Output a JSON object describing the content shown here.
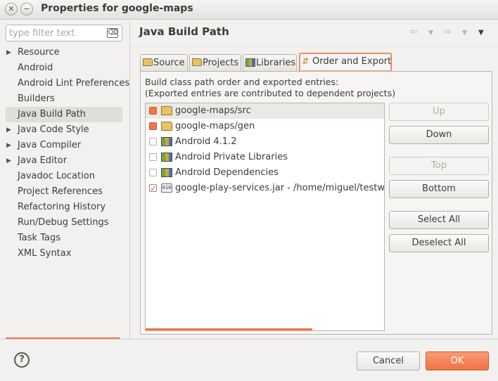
{
  "window": {
    "title": "Properties for google-maps",
    "close_glyph": "✕",
    "minimize_glyph": "−"
  },
  "sidebar": {
    "filter_placeholder": "type filter text",
    "filter_value": "",
    "items": [
      {
        "label": "Resource",
        "expandable": true
      },
      {
        "label": "Android",
        "expandable": false
      },
      {
        "label": "Android Lint Preferences",
        "expandable": false
      },
      {
        "label": "Builders",
        "expandable": false
      },
      {
        "label": "Java Build Path",
        "expandable": false,
        "selected": true
      },
      {
        "label": "Java Code Style",
        "expandable": true
      },
      {
        "label": "Java Compiler",
        "expandable": true
      },
      {
        "label": "Java Editor",
        "expandable": true
      },
      {
        "label": "Javadoc Location",
        "expandable": false
      },
      {
        "label": "Project References",
        "expandable": false
      },
      {
        "label": "Refactoring History",
        "expandable": false
      },
      {
        "label": "Run/Debug Settings",
        "expandable": false
      },
      {
        "label": "Task Tags",
        "expandable": false
      },
      {
        "label": "XML Syntax",
        "expandable": false
      }
    ]
  },
  "page": {
    "title": "Java Build Path",
    "icons": [
      "back-arrow-icon",
      "back-dropdown-icon",
      "forward-arrow-icon",
      "forward-dropdown-icon",
      "view-menu-icon"
    ]
  },
  "tabs": [
    {
      "label": "Source",
      "icon": "source-folder-icon"
    },
    {
      "label": "Projects",
      "icon": "projects-folder-icon"
    },
    {
      "label": "Libraries",
      "icon": "libraries-icon"
    },
    {
      "label": "Order and Export",
      "icon": "order-export-icon",
      "active": true
    }
  ],
  "order_export": {
    "description_line1": "Build class path order and exported entries:",
    "description_line2": "(Exported entries are contributed to dependent projects)",
    "entries": [
      {
        "label": "google-maps/src",
        "checked": true,
        "icon": "package-folder-icon",
        "selected": true
      },
      {
        "label": "google-maps/gen",
        "checked": true,
        "icon": "package-folder-icon"
      },
      {
        "label": "Android 4.1.2",
        "checked": false,
        "icon": "library-icon"
      },
      {
        "label": "Android Private Libraries",
        "checked": false,
        "icon": "library-icon"
      },
      {
        "label": "Android Dependencies",
        "checked": false,
        "icon": "library-icon"
      },
      {
        "label": "google-play-services.jar - /home/miguel/testworks",
        "checked": true,
        "icon": "jar-icon"
      }
    ],
    "jar_icon_text": "010",
    "buttons": {
      "up": "Up",
      "down": "Down",
      "top": "Top",
      "bottom": "Bottom",
      "select_all": "Select All",
      "deselect_all": "Deselect All"
    }
  },
  "footer": {
    "help_glyph": "?",
    "cancel_label": "Cancel",
    "ok_label": "OK"
  },
  "colors": {
    "accent": "#ef7446",
    "selection": "#e0ded9"
  }
}
